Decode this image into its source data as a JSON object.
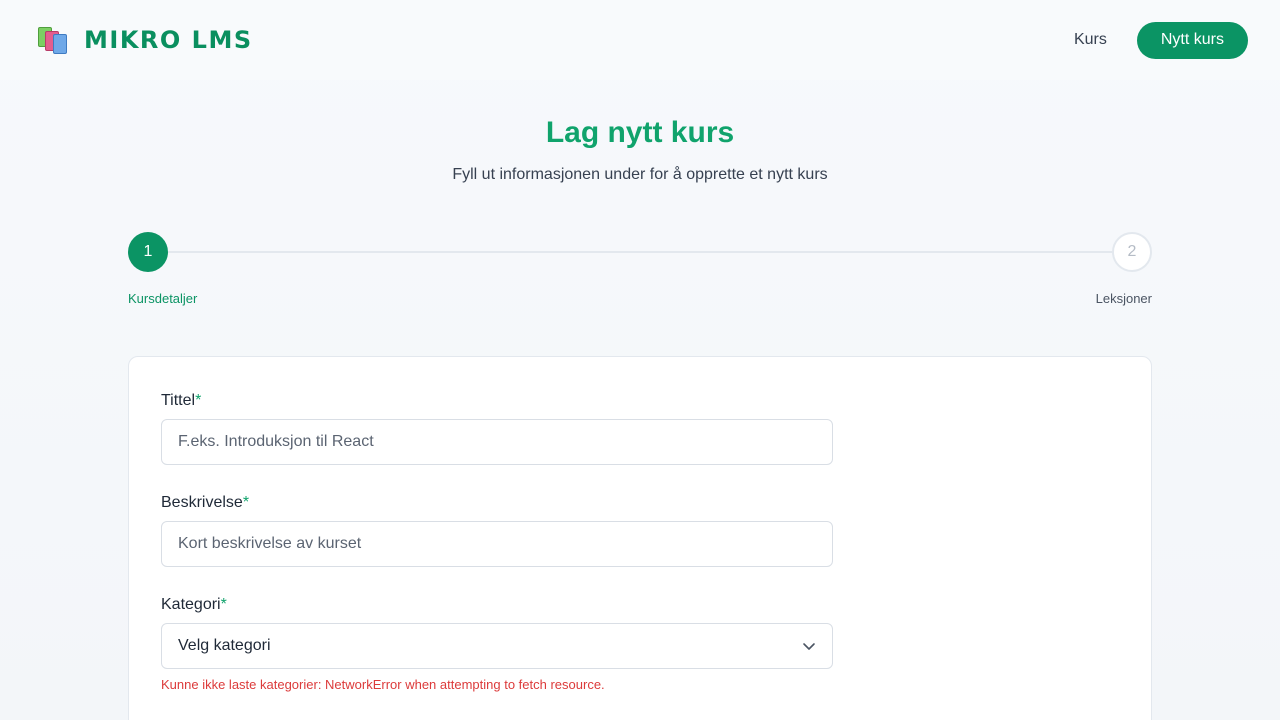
{
  "header": {
    "logo_text": "MIKRO LMS",
    "nav": {
      "courses_link": "Kurs",
      "new_course_button": "Nytt kurs"
    }
  },
  "page": {
    "title": "Lag nytt kurs",
    "subtitle": "Fyll ut informasjonen under for å opprette et nytt kurs"
  },
  "stepper": {
    "steps": [
      {
        "number": "1",
        "label": "Kursdetaljer",
        "state": "active"
      },
      {
        "number": "2",
        "label": "Leksjoner",
        "state": "inactive"
      }
    ]
  },
  "form": {
    "title_field": {
      "label": "Tittel",
      "required_mark": "*",
      "placeholder": "F.eks. Introduksjon til React",
      "value": ""
    },
    "description_field": {
      "label": "Beskrivelse",
      "required_mark": "*",
      "placeholder": "Kort beskrivelse av kurset",
      "value": ""
    },
    "category_field": {
      "label": "Kategori",
      "required_mark": "*",
      "selected": "Velg kategori",
      "error": "Kunne ikke laste kategorier: NetworkError when attempting to fetch resource."
    }
  },
  "colors": {
    "brand": "#0b9464",
    "title": "#10a36c",
    "error": "#dc3b3b"
  },
  "icons": {
    "logo": "books-icon",
    "select": "chevron-down-icon"
  }
}
